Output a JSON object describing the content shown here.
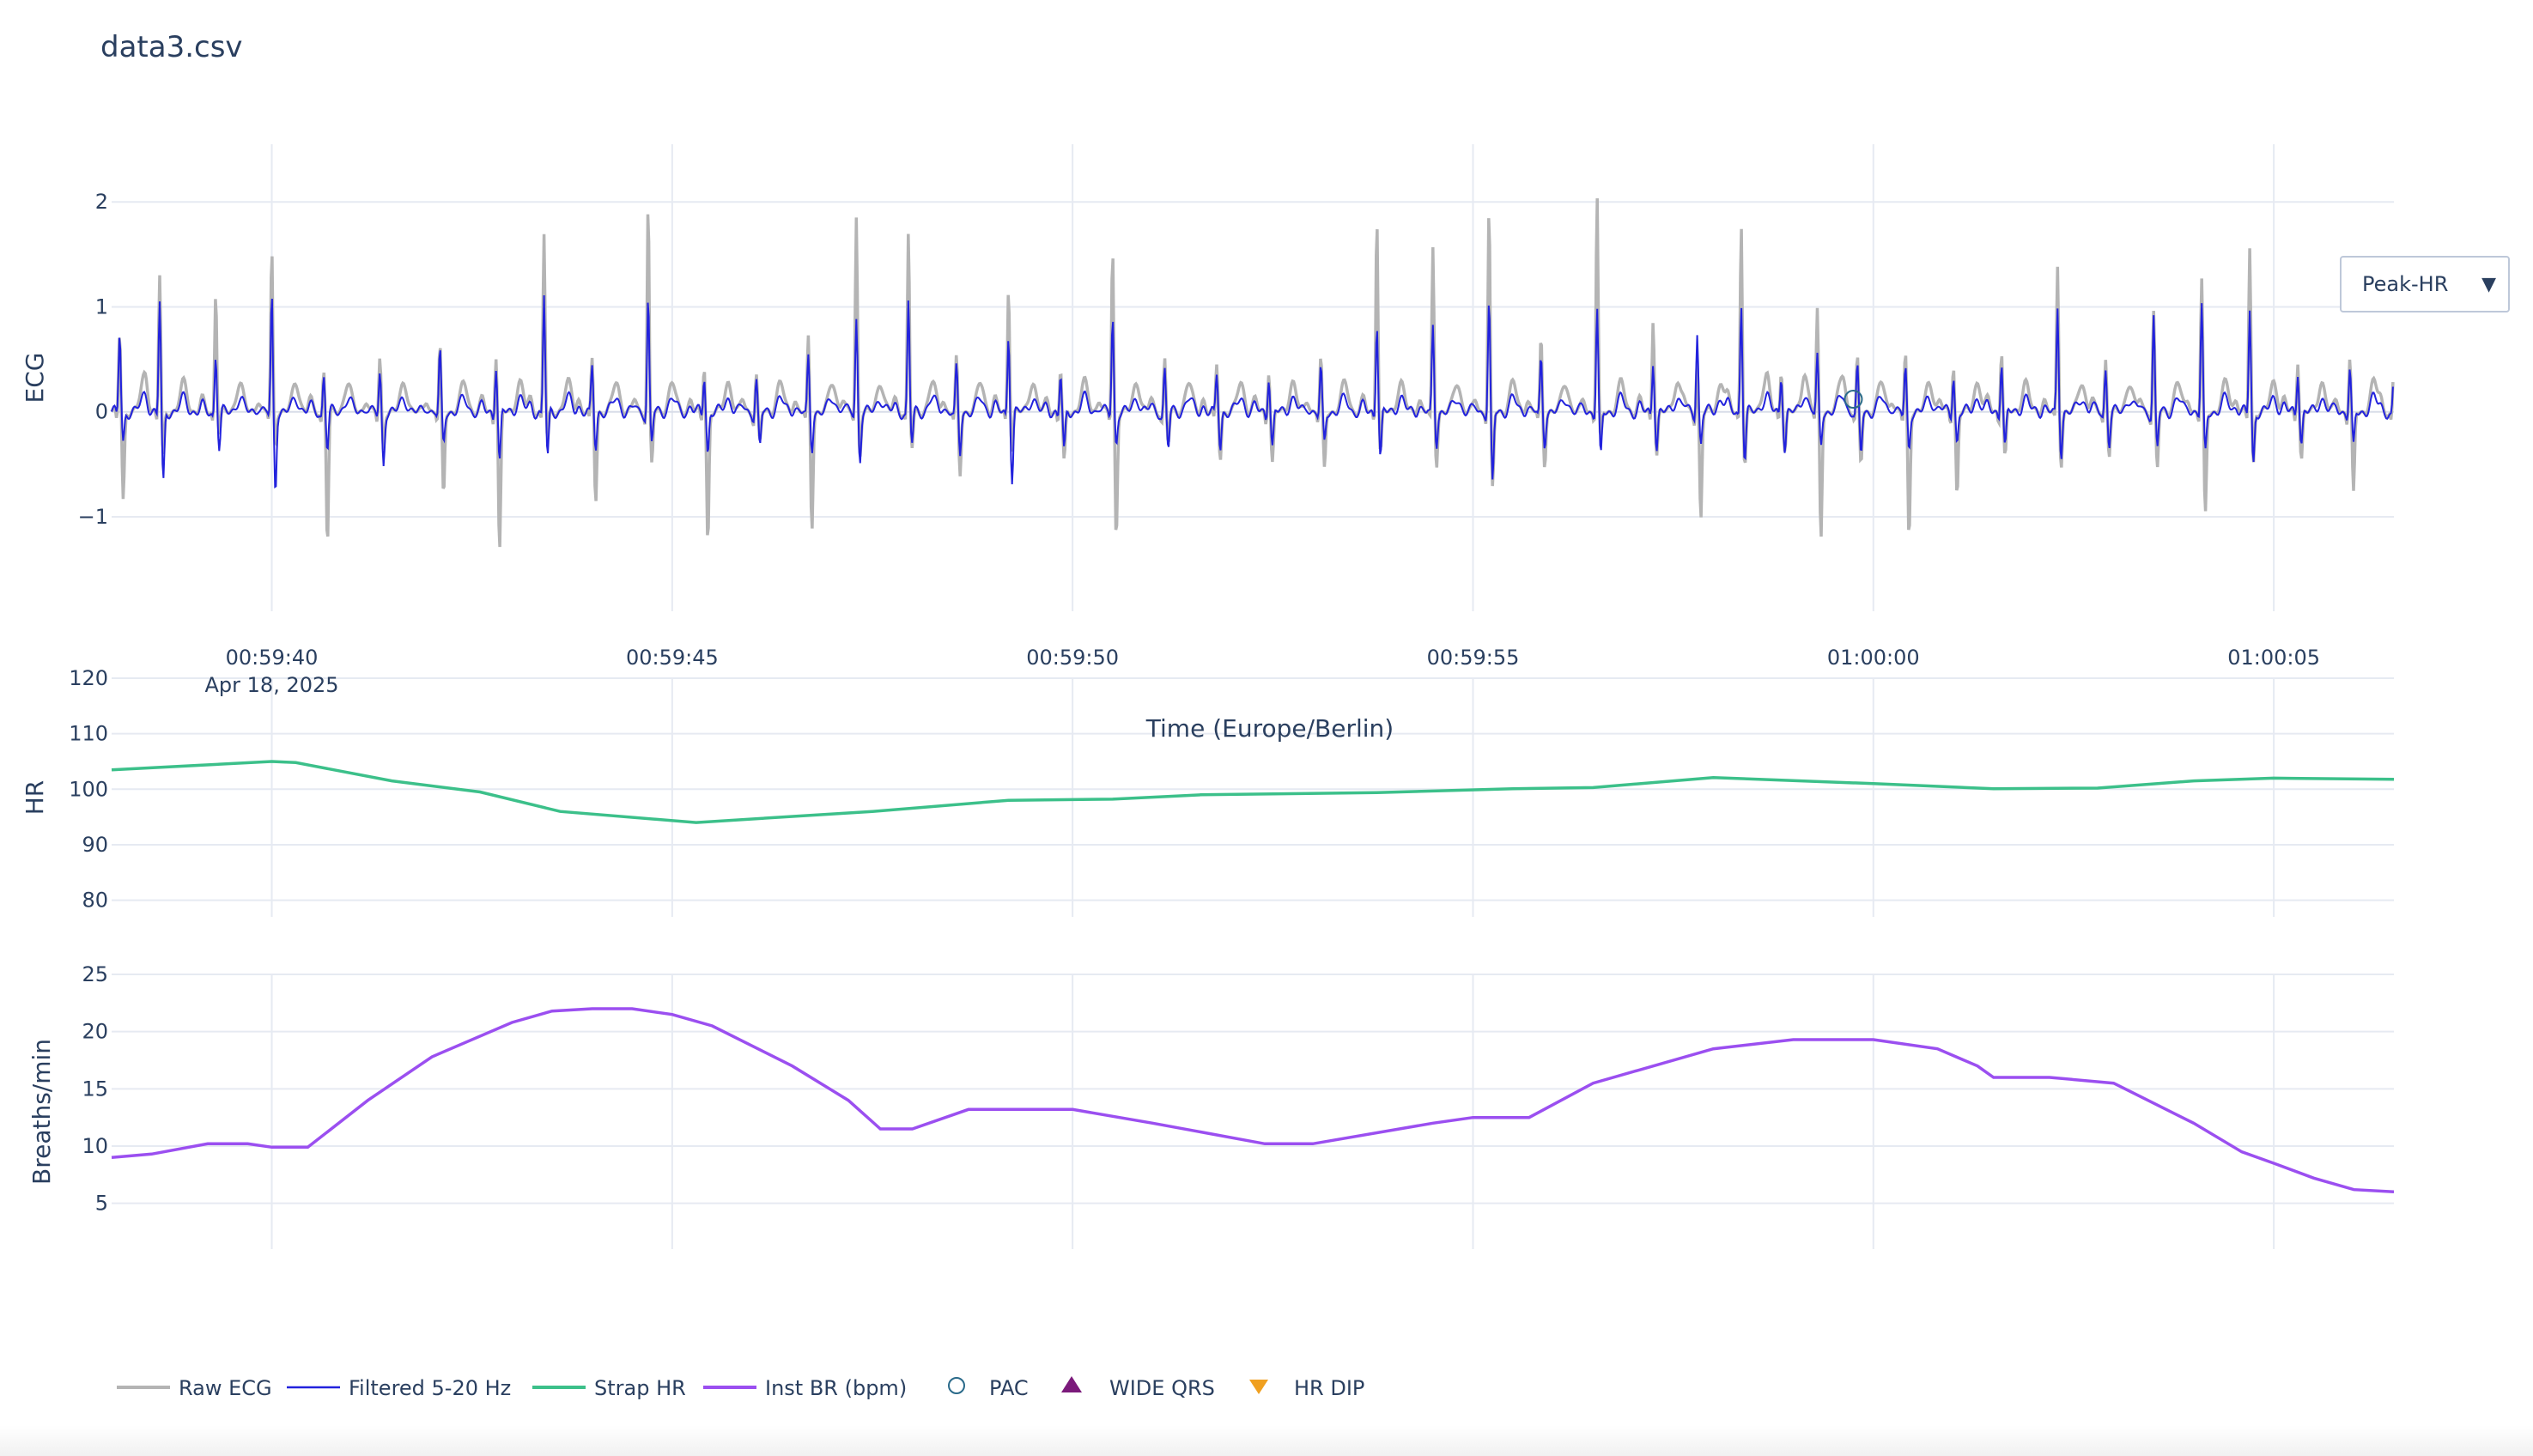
{
  "title": "data3.csv",
  "dropdown": {
    "selected": "Peak-HR",
    "arrow_icon": "triangle-down-icon"
  },
  "colors": {
    "raw_ecg": "#b4b4b4",
    "filtered": "#2222dd",
    "strap_hr": "#3cc08a",
    "inst_br": "#9b4ff0",
    "pac": "#2a6a8a",
    "wide_qrs": "#7b1a7b",
    "hr_dip": "#f0a020",
    "grid": "#e6eaf2",
    "text": "#2a3f5f"
  },
  "chart_data": {
    "type": "line",
    "x_axis": {
      "title": "Time (Europe/Berlin)",
      "ticks": [
        "00:59:40",
        "00:59:45",
        "00:59:50",
        "00:59:55",
        "01:00:00",
        "01:00:05"
      ],
      "date_label": "Apr 18, 2025",
      "range": [
        "00:59:38",
        "01:00:06.5"
      ]
    },
    "panels": [
      {
        "id": "ecg",
        "ylabel": "ECG",
        "yticks": [
          "2",
          "1",
          "0",
          "−1"
        ],
        "ylim": [
          -1.9,
          2.55
        ]
      },
      {
        "id": "hr",
        "ylabel": "HR",
        "yticks": [
          "120",
          "110",
          "100",
          "90",
          "80"
        ],
        "ylim": [
          77,
          120
        ]
      },
      {
        "id": "br",
        "ylabel": "Breaths/min",
        "yticks": [
          "25",
          "20",
          "15",
          "10",
          "5"
        ],
        "ylim": [
          1,
          25
        ]
      }
    ],
    "series": [
      {
        "name": "Raw ECG",
        "panel": "ecg",
        "kind": "synthetic-ecg",
        "beat_times_s": [
          0.1,
          0.6,
          1.3,
          2.0,
          2.65,
          3.35,
          4.1,
          4.8,
          5.4,
          6.0,
          6.7,
          7.4,
          8.05,
          8.7,
          9.3,
          9.95,
          10.55,
          11.2,
          11.85,
          12.5,
          13.15,
          13.8,
          14.45,
          15.1,
          15.8,
          16.5,
          17.2,
          17.85,
          18.55,
          19.25,
          19.8,
          20.35,
          20.85,
          21.3,
          21.8,
          22.4,
          23.0,
          23.6,
          24.3,
          24.9,
          25.5,
          26.1,
          26.7,
          27.3,
          27.95,
          28.5
        ],
        "peak_values": [
          0.75,
          1.3,
          1.15,
          1.53,
          0.4,
          0.5,
          0.6,
          0.55,
          1.7,
          0.5,
          1.97,
          0.45,
          0.35,
          0.7,
          1.85,
          1.7,
          0.5,
          1.2,
          0.4,
          1.55,
          0.5,
          0.45,
          0.4,
          0.5,
          1.88,
          1.55,
          1.93,
          0.7,
          2.05,
          0.9,
          0.5,
          1.8,
          0.4,
          0.95,
          0.5,
          0.55,
          0.45,
          0.6,
          1.38,
          0.5,
          0.95,
          1.25,
          1.57,
          0.5,
          0.5,
          0.4
        ],
        "trough_values": [
          -0.85,
          -0.45,
          -0.2,
          -0.3,
          -1.25,
          -0.35,
          -0.8,
          -1.35,
          -0.3,
          -0.85,
          -0.5,
          -1.25,
          -0.3,
          -1.1,
          -0.4,
          -0.35,
          -0.6,
          -0.35,
          -0.5,
          -1.2,
          -0.3,
          -0.45,
          -0.5,
          -0.55,
          -0.4,
          -0.5,
          -0.75,
          -0.5,
          -0.3,
          -0.4,
          -1.02,
          -0.5,
          -0.35,
          -1.2,
          -0.5,
          -1.2,
          -0.8,
          -0.45,
          -0.5,
          -0.4,
          -0.55,
          -1.0,
          -0.5,
          -0.45,
          -0.8,
          -0.4
        ]
      },
      {
        "name": "Filtered 5-20 Hz",
        "panel": "ecg",
        "kind": "synthetic-ecg-filtered",
        "peak_values": [
          0.75,
          1.05,
          0.55,
          1.1,
          0.35,
          0.35,
          0.55,
          0.45,
          1.12,
          0.42,
          1.08,
          0.35,
          0.3,
          0.5,
          0.88,
          1.05,
          0.4,
          0.75,
          0.35,
          0.9,
          0.4,
          0.35,
          0.35,
          0.4,
          0.88,
          0.8,
          1.05,
          0.5,
          0.98,
          0.5,
          0.75,
          1.05,
          0.35,
          0.5,
          0.4,
          0.4,
          0.35,
          0.5,
          0.98,
          0.4,
          0.9,
          1.0,
          0.98,
          0.4,
          0.4,
          0.3
        ],
        "trough_values": [
          -0.3,
          -0.7,
          -0.35,
          -0.75,
          -0.35,
          -0.5,
          -0.3,
          -0.5,
          -0.45,
          -0.35,
          -0.3,
          -0.4,
          -0.35,
          -0.35,
          -0.45,
          -0.3,
          -0.4,
          -0.65,
          -0.4,
          -0.3,
          -0.35,
          -0.35,
          -0.35,
          -0.3,
          -0.45,
          -0.3,
          -0.7,
          -0.3,
          -0.45,
          -0.35,
          -0.3,
          -0.45,
          -0.35,
          -0.3,
          -0.4,
          -0.35,
          -0.3,
          -0.35,
          -0.4,
          -0.3,
          -0.35,
          -0.4,
          -0.5,
          -0.3,
          -0.35,
          -0.35
        ]
      },
      {
        "name": "Strap HR",
        "panel": "hr",
        "x_s": [
          0,
          2.0,
          2.3,
          3.5,
          4.6,
          5.6,
          7.3,
          9.5,
          11.2,
          12.5,
          13.6,
          15.8,
          17.5,
          18.5,
          20.0,
          22.0,
          23.5,
          24.8,
          26.0,
          27.0,
          28.5
        ],
        "y": [
          103.5,
          105.0,
          104.8,
          101.5,
          99.5,
          96.0,
          94.0,
          96.0,
          98.0,
          98.2,
          99.0,
          99.4,
          100.1,
          100.3,
          102.1,
          101.0,
          100.1,
          100.2,
          101.5,
          102.0,
          101.8
        ]
      },
      {
        "name": "Inst BR (bpm)",
        "panel": "br",
        "x_s": [
          0,
          0.5,
          1.2,
          1.7,
          2.0,
          2.3,
          2.45,
          3.2,
          4.0,
          5.0,
          5.5,
          6.0,
          6.5,
          7.0,
          7.5,
          8.5,
          9.2,
          9.6,
          9.7,
          10.0,
          10.7,
          12.0,
          13.0,
          14.4,
          15.0,
          16.5,
          17.0,
          17.7,
          18.5,
          20.0,
          21.0,
          21.5,
          22.0,
          22.8,
          23.3,
          23.5,
          24.2,
          25.0,
          26.0,
          26.6,
          27.0,
          27.5,
          28.0,
          28.5
        ],
        "y": [
          9.0,
          9.3,
          10.2,
          10.2,
          9.9,
          9.9,
          9.9,
          14.0,
          17.8,
          20.8,
          21.8,
          22.0,
          22.0,
          21.5,
          20.5,
          17.0,
          14.0,
          11.5,
          11.5,
          11.5,
          13.2,
          13.2,
          12.0,
          10.2,
          10.2,
          12.0,
          12.5,
          12.5,
          15.5,
          18.5,
          19.3,
          19.3,
          19.3,
          18.5,
          17.0,
          16.0,
          16.0,
          15.5,
          12.0,
          9.5,
          8.5,
          7.2,
          6.2,
          6.0
        ]
      },
      {
        "name": "PAC",
        "panel": "ecg",
        "marker": "circle-open",
        "x_s": [
          21.75
        ],
        "y": [
          0.12
        ]
      },
      {
        "name": "WIDE QRS",
        "panel": "ecg",
        "marker": "triangle-up",
        "x_s": [],
        "y": []
      },
      {
        "name": "HR DIP",
        "panel": "ecg",
        "marker": "triangle-down",
        "x_s": [],
        "y": []
      }
    ],
    "legend": {
      "placement": "bottom-left",
      "entries": [
        "Raw ECG",
        "Filtered 5-20 Hz",
        "Strap HR",
        "Inst BR (bpm)",
        "PAC",
        "WIDE QRS",
        "HR DIP"
      ]
    },
    "grid": true
  }
}
